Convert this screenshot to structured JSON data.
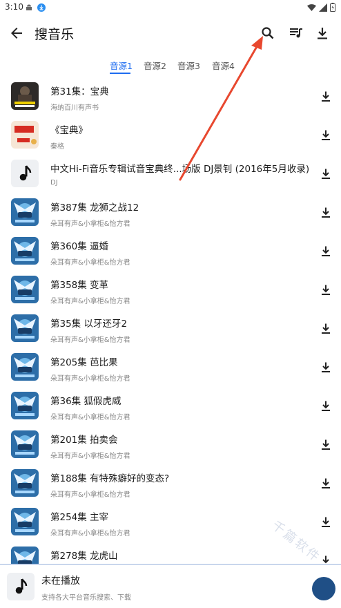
{
  "status_bar": {
    "time": "3:10"
  },
  "app_bar": {
    "title": "搜音乐"
  },
  "tabs": [
    {
      "label": "音源1",
      "active": true
    },
    {
      "label": "音源2",
      "active": false
    },
    {
      "label": "音源3",
      "active": false
    },
    {
      "label": "音源4",
      "active": false
    }
  ],
  "accent_color": "#1e6cf0",
  "annotation_arrow_color": "#e8482f",
  "songs": [
    {
      "title": "第31集：宝典",
      "artist": "海纳百川有声书",
      "cover": "cover-book-dark"
    },
    {
      "title": "《宝典》",
      "artist": "秦格",
      "cover": "cover-book-red"
    },
    {
      "title": "中文Hi-Fi音乐专辑试音宝典终...场版 DJ景钊 (2016年5月收录)",
      "artist": "DJ",
      "cover": "music-note-icon"
    },
    {
      "title": "第387集  龙狮之战12",
      "artist": "朵耳有声&小拿柜&怡方君",
      "cover": "cover-audiobook"
    },
    {
      "title": "第360集  逼婚",
      "artist": "朵耳有声&小拿柜&怡方君",
      "cover": "cover-audiobook"
    },
    {
      "title": "第358集  变革",
      "artist": "朵耳有声&小拿柜&怡方君",
      "cover": "cover-audiobook"
    },
    {
      "title": "第35集 以牙还牙2",
      "artist": "朵耳有声&小拿柜&怡方君",
      "cover": "cover-audiobook"
    },
    {
      "title": "第205集  芭比果",
      "artist": "朵耳有声&小拿柜&怡方君",
      "cover": "cover-audiobook"
    },
    {
      "title": "第36集  狐假虎威",
      "artist": "朵耳有声&小拿柜&怡方君",
      "cover": "cover-audiobook"
    },
    {
      "title": "第201集  拍卖会",
      "artist": "朵耳有声&小拿柜&怡方君",
      "cover": "cover-audiobook"
    },
    {
      "title": "第188集 有特殊癖好的变态?",
      "artist": "朵耳有声&小拿柜&怡方君",
      "cover": "cover-audiobook"
    },
    {
      "title": "第254集  主宰",
      "artist": "朵耳有声&小拿柜&怡方君",
      "cover": "cover-audiobook"
    },
    {
      "title": "第278集    龙虎山",
      "artist": "",
      "cover": "cover-audiobook"
    }
  ],
  "player": {
    "title": "未在播放",
    "subtitle": "支持各大平台音乐搜索、下载"
  }
}
